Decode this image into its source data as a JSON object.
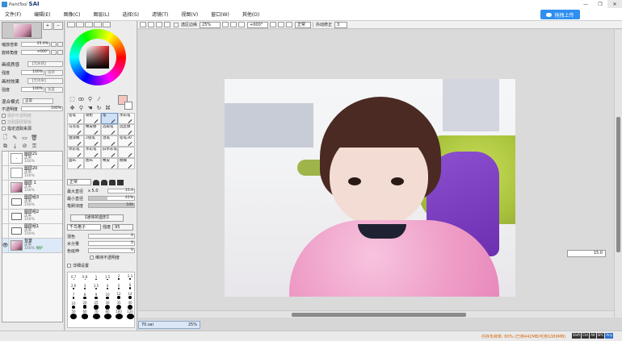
{
  "app": {
    "logo_small": "PaintTool",
    "logo_big": "SAI",
    "upload_label": "拖拽上传"
  },
  "menu": [
    "文件(F)",
    "编辑(E)",
    "图像(C)",
    "图层(L)",
    "选择(S)",
    "滤镜(T)",
    "视图(V)",
    "窗口(W)",
    "其他(O)"
  ],
  "window_buttons": [
    "—",
    "❐",
    "✕"
  ],
  "toolbar": {
    "sel_edge_label": "选区边缘",
    "zoom": "25%",
    "angle": "+000°",
    "blend": "正常",
    "stabilizer_label": "抖动修正",
    "stabilizer_value": "3"
  },
  "navigator": {
    "zoom_label": "缩放倍率",
    "zoom_value": "25.0%",
    "angle_label": "旋转角度",
    "angle_value": "+000°"
  },
  "paper_texture": {
    "title": "画纸质感",
    "value": "【无质感】",
    "row_label": "强度",
    "row_value": "100%",
    "btn": "倍率"
  },
  "paper_effect": {
    "title": "画材效果",
    "value": "【无效果】",
    "row_label": "强度",
    "row_value": "100%",
    "btn": "宽度"
  },
  "layer_props": {
    "blend_label": "混合模式",
    "blend_value": "正常",
    "opacity_label": "不透明度",
    "opacity_value": "100%",
    "checks": [
      "保护不透明度",
      "剪贴图层蒙版",
      "指定选取来源"
    ]
  },
  "layers": [
    {
      "name": "图层21",
      "mode": "正常",
      "opacity": "100%",
      "type": "layer",
      "thumb": "·"
    },
    {
      "name": "图层20",
      "mode": "正常",
      "opacity": "100%",
      "type": "layer",
      "thumb": ""
    },
    {
      "name": "图层 1",
      "mode": "正常",
      "opacity": "100%",
      "type": "image",
      "thumb": ""
    },
    {
      "name": "图层组3",
      "mode": "正常",
      "opacity": "100%",
      "type": "folder",
      "thumb": ""
    },
    {
      "name": "图层组2",
      "mode": "正常",
      "opacity": "100%",
      "type": "folder",
      "thumb": ""
    },
    {
      "name": "图层组1",
      "mode": "正常",
      "opacity": "100%",
      "type": "folder",
      "thumb": ""
    },
    {
      "name": "背景",
      "mode": "正常",
      "opacity": "100%",
      "type": "image",
      "thumb": "",
      "extra": "保护"
    }
  ],
  "brushes": [
    "铅笔",
    "喷枪",
    "笔",
    "水彩笔",
    "马克笔",
    "橡皮擦",
    "选取笔",
    "选区擦",
    "油漆桶",
    "2值笔",
    "湿笔",
    "铅笔30",
    "水彩笔",
    "水彩笔",
    "旧水彩笔",
    "",
    "画布",
    "图布",
    "橡皮",
    "模糊"
  ],
  "brush_settings": {
    "mode": "正常",
    "max_size_label": "最大直径",
    "max_size_mult": "x 5.0",
    "max_size_value": "15.0",
    "min_size_label": "最小直径",
    "min_size_value": "41%",
    "density_label": "笔刷浓度",
    "density_value": "100",
    "blend_btn": "【通常的圆形】",
    "texture": "千鸟格子",
    "texture_strength_label": "强度",
    "texture_strength": "95",
    "mix_label": "混色",
    "mix_value": "0",
    "water_label": "水分量",
    "water_value": "0",
    "stretch_label": "色延伸",
    "stretch_value": "0",
    "keep_opacity": "维持不透明度",
    "detail": "详细设置"
  },
  "brush_sizes": [
    "0.7",
    "0.8",
    "1",
    "1.5",
    "2",
    "2.3",
    "2.6",
    "3",
    "3.5",
    "4",
    "5",
    "6",
    "7",
    "8",
    "9",
    "10",
    "12",
    "14",
    "16",
    "20",
    "25",
    "30",
    "35",
    "40",
    "50",
    "60",
    "70",
    "80",
    "100",
    "120"
  ],
  "canvas": {
    "rotate_value": "15.0"
  },
  "file_tab": {
    "name": "70.sai",
    "zoom": "25%"
  },
  "status": {
    "memory": "内存负荷率: 80% (已用442MB/可用1089MB)",
    "keys": [
      "Shift",
      "Ctrl",
      "Alt",
      "SPC",
      "Any"
    ]
  },
  "colors": {
    "accent": "#2f8ff0",
    "primary_color": "#f2c5be",
    "memory_text": "#d36a10"
  }
}
